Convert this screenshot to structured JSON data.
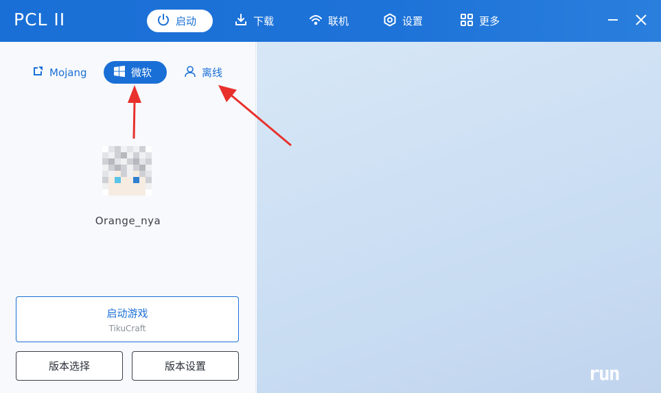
{
  "app": {
    "title": "PCL II"
  },
  "nav": [
    {
      "label": "启动",
      "icon": "power-icon",
      "active": true
    },
    {
      "label": "下载",
      "icon": "download-icon",
      "active": false
    },
    {
      "label": "联机",
      "icon": "wifi-icon",
      "active": false
    },
    {
      "label": "设置",
      "icon": "gear-icon",
      "active": false
    },
    {
      "label": "更多",
      "icon": "grid-icon",
      "active": false
    }
  ],
  "window_controls": {
    "minimize_icon": "minimize-icon",
    "close_icon": "close-icon"
  },
  "login_tabs": [
    {
      "label": "Mojang",
      "icon": "mojang-icon",
      "active": false
    },
    {
      "label": "微软",
      "icon": "windows-icon",
      "active": true
    },
    {
      "label": "离线",
      "icon": "user-icon",
      "active": false
    }
  ],
  "profile": {
    "username": "Orange_nya",
    "avatar_icon": "pixel-avatar-icon"
  },
  "launch": {
    "label": "启动游戏",
    "version": "TikuCraft"
  },
  "buttons": {
    "version_select": "版本选择",
    "version_settings": "版本设置"
  },
  "watermark": "run",
  "colors": {
    "accent": "#1a6fd6",
    "panel_bg": "#f7f9fc",
    "annotation_arrow": "#e8302c"
  }
}
